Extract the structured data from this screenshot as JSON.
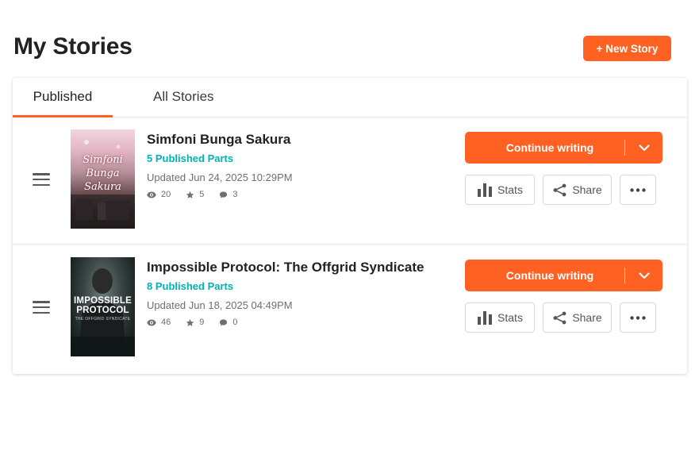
{
  "page": {
    "title": "My Stories",
    "new_story_label": "+ New Story"
  },
  "tabs": [
    {
      "label": "Published",
      "active": true
    },
    {
      "label": "All Stories",
      "active": false
    }
  ],
  "stories": [
    {
      "title": "Simfoni Bunga Sakura",
      "parts": "5 Published Parts",
      "updated": "Updated Jun 24, 2025 10:29PM",
      "views": "20",
      "votes": "5",
      "comments": "3",
      "cover_text": "Simfoni Bunga Sakura"
    },
    {
      "title": "Impossible Protocol: The Offgrid Syndicate",
      "parts": "8 Published Parts",
      "updated": "Updated Jun 18, 2025 04:49PM",
      "views": "46",
      "votes": "9",
      "comments": "0",
      "cover_line1": "IMPOSSIBLE",
      "cover_line2": "PROTOCOL",
      "cover_line3": "THE OFFGRID SYNDICATE"
    }
  ],
  "actions": {
    "continue_label": "Continue writing",
    "stats_label": "Stats",
    "share_label": "Share"
  },
  "icons": {
    "views": "eye-icon",
    "votes": "star-icon",
    "comments": "comment-icon",
    "stats": "bar-chart-icon",
    "share": "share-icon",
    "more": "more-dots-icon",
    "dropdown": "chevron-down-icon",
    "drag": "drag-handle-icon"
  },
  "colors": {
    "accent": "#ff6122",
    "teal": "#00b2b2"
  }
}
